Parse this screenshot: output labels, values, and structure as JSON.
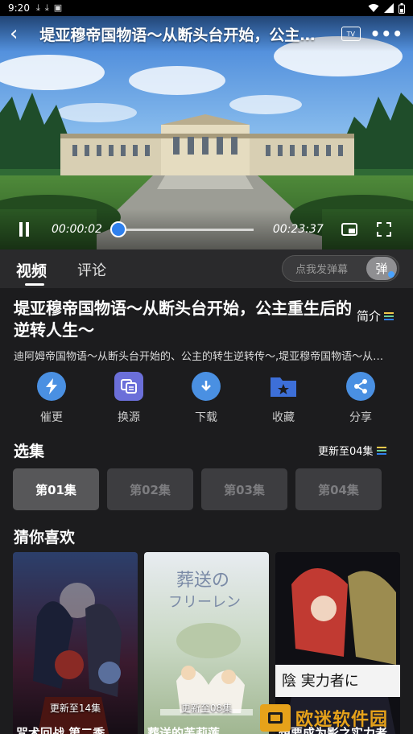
{
  "status_bar": {
    "time": "9:20",
    "icons": [
      "download-icon",
      "download-icon",
      "a-icon"
    ],
    "right_icons": [
      "wifi-icon",
      "signal-icon",
      "battery-icon"
    ]
  },
  "player": {
    "title": "堤亚穆帝国物语～从断头台开始，公主重生后的逆转人生～",
    "current_time": "00:00:02",
    "duration": "00:23:37",
    "progress": 0.0014,
    "tv_label": "TV"
  },
  "tabs": [
    {
      "label": "视频"
    },
    {
      "label": "评论"
    }
  ],
  "danmu": {
    "placeholder": "点我发弹幕",
    "button_label": "弹"
  },
  "info": {
    "title": "堤亚穆帝国物语～从断头台开始，公主重生后的逆转人生～",
    "intro_label": "简介",
    "description": "迪阿姆帝国物语～从断头台开始的、公主的转生逆转传～,堤亚穆帝国物语～从断头台开始，公主重生后的逆转人生～"
  },
  "actions": [
    {
      "label": "催更",
      "icon": "lightning-icon"
    },
    {
      "label": "换源",
      "icon": "switch-source-icon"
    },
    {
      "label": "下载",
      "icon": "download-icon"
    },
    {
      "label": "收藏",
      "icon": "folder-star-icon"
    },
    {
      "label": "分享",
      "icon": "share-icon"
    }
  ],
  "episodes": {
    "section_title": "选集",
    "update_label": "更新至04集",
    "items": [
      {
        "label": "第01集"
      },
      {
        "label": "第02集"
      },
      {
        "label": "第03集"
      },
      {
        "label": "第04集"
      }
    ]
  },
  "recommend": {
    "section_title": "猜你喜欢",
    "items": [
      {
        "badge": "更新至14集",
        "title": "咒术回战 第二季"
      },
      {
        "badge": "更新至08集",
        "title": "葬送的芙莉莲"
      },
      {
        "badge": "",
        "title": "想要成为影之实力者"
      }
    ]
  },
  "colors": {
    "accent": "#4a90e2",
    "watermark": "#e6a21a"
  }
}
